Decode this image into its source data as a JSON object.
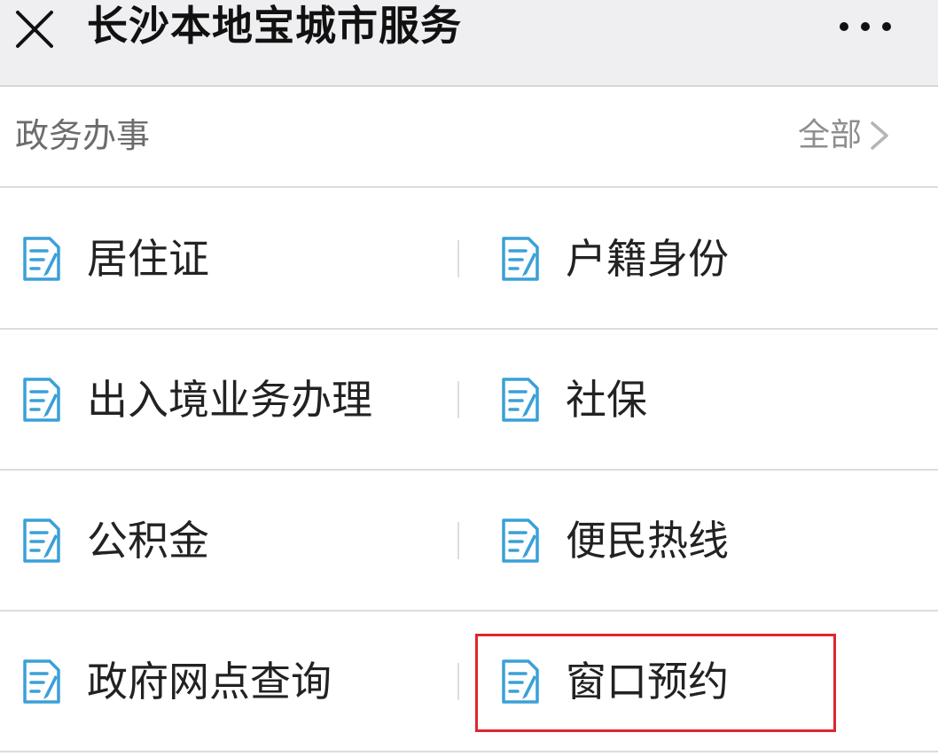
{
  "header": {
    "title": "长沙本地宝城市服务",
    "close_icon": "close-icon",
    "more_icon": "more-icon"
  },
  "section": {
    "title": "政务办事",
    "all_label": "全部"
  },
  "services": {
    "rows": [
      {
        "left": {
          "label": "居住证",
          "icon": "document-edit-icon"
        },
        "right": {
          "label": "户籍身份",
          "icon": "document-edit-icon"
        }
      },
      {
        "left": {
          "label": "出入境业务办理",
          "icon": "document-edit-icon"
        },
        "right": {
          "label": "社保",
          "icon": "document-edit-icon"
        }
      },
      {
        "left": {
          "label": "公积金",
          "icon": "document-edit-icon"
        },
        "right": {
          "label": "便民热线",
          "icon": "document-edit-icon"
        }
      },
      {
        "left": {
          "label": "政府网点查询",
          "icon": "document-edit-icon"
        },
        "right": {
          "label": "窗口预约",
          "icon": "document-edit-icon"
        }
      }
    ]
  },
  "colors": {
    "icon_blue": "#3aa0d8",
    "highlight_red": "#e0262c",
    "header_bg": "#efeff2"
  }
}
